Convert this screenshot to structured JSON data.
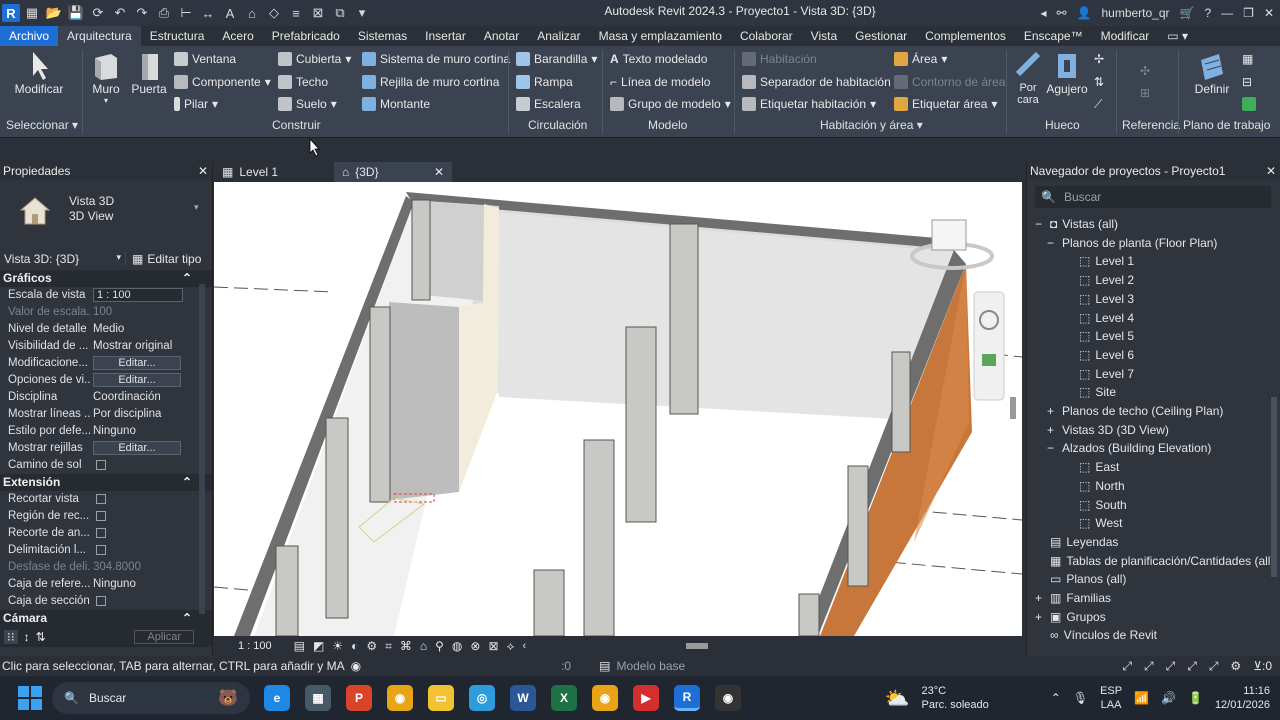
{
  "window": {
    "title": "Autodesk Revit 2024.3 - Proyecto1 - Vista 3D: {3D}",
    "user": "humberto_qr"
  },
  "menu": {
    "tabs": [
      "Archivo",
      "Arquitectura",
      "Estructura",
      "Acero",
      "Prefabricado",
      "Sistemas",
      "Insertar",
      "Anotar",
      "Analizar",
      "Masa y emplazamiento",
      "Colaborar",
      "Vista",
      "Gestionar",
      "Complementos",
      "Enscape™",
      "Modificar"
    ],
    "active_tab": "Arquitectura"
  },
  "ribbon": {
    "select": {
      "big": "Modificar",
      "panel": "Seleccionar"
    },
    "build": {
      "wall": "Muro",
      "door": "Puerta",
      "window": "Ventana",
      "component": "Componente",
      "column": "Pilar",
      "roof": "Cubierta",
      "ceiling": "Techo",
      "floor": "Suelo",
      "curtain_system": "Sistema de muro cortina",
      "curtain_grid": "Rejilla de muro cortina",
      "mullion": "Montante",
      "panel": "Construir"
    },
    "circulation": {
      "railing": "Barandilla",
      "ramp": "Rampa",
      "stair": "Escalera",
      "panel": "Circulación"
    },
    "model": {
      "text": "Texto modelado",
      "line": "Línea de modelo",
      "group": "Grupo de modelo",
      "panel": "Modelo"
    },
    "room_area": {
      "room": "Habitación",
      "separator": "Separador  de habitación",
      "tag_room": "Etiquetar  habitación",
      "area": "Área",
      "area_boundary": "Contorno  de área",
      "tag_area": "Etiquetar  área",
      "panel": "Habitación y área"
    },
    "opening": {
      "by_face": "Por cara",
      "shaft": "Agujero",
      "panel": "Hueco"
    },
    "datum": {
      "panel": "Referencia"
    },
    "workplane": {
      "set": "Definir",
      "panel": "Plano de trabajo"
    }
  },
  "properties": {
    "title": "Propiedades",
    "type_name": "Vista 3D",
    "type_sub": "3D View",
    "selector": "Vista 3D: {3D}",
    "edit_type": "Editar tipo",
    "sections": {
      "graphics": "Gráficos",
      "extents": "Extensión",
      "camera": "Cámara"
    },
    "graphics_rows": [
      {
        "k": "Escala de vista",
        "v": "1 : 100",
        "kind": "input"
      },
      {
        "k": "Valor de escala...",
        "v": "100",
        "kind": "dis"
      },
      {
        "k": "Nivel de detalle",
        "v": "Medio",
        "kind": "text"
      },
      {
        "k": "Visibilidad de ...",
        "v": "Mostrar original",
        "kind": "text"
      },
      {
        "k": "Modificacione...",
        "v": "Editar...",
        "kind": "button"
      },
      {
        "k": "Opciones de vi...",
        "v": "Editar...",
        "kind": "button"
      },
      {
        "k": "Disciplina",
        "v": "Coordinación",
        "kind": "text"
      },
      {
        "k": "Mostrar líneas ...",
        "v": "Por disciplina",
        "kind": "text"
      },
      {
        "k": "Estilo por defe...",
        "v": "Ninguno",
        "kind": "text"
      },
      {
        "k": "Mostrar rejillas",
        "v": "Editar...",
        "kind": "button"
      },
      {
        "k": "Camino de sol",
        "v": "",
        "kind": "check"
      }
    ],
    "extent_rows": [
      {
        "k": "Recortar vista",
        "v": "",
        "kind": "check"
      },
      {
        "k": "Región de rec...",
        "v": "",
        "kind": "check"
      },
      {
        "k": "Recorte de an...",
        "v": "",
        "kind": "check"
      },
      {
        "k": "Delimitación l...",
        "v": "",
        "kind": "check"
      },
      {
        "k": "Desfase de deli...",
        "v": "304.8000",
        "kind": "dis"
      },
      {
        "k": "Caja de refere...",
        "v": "Ninguno",
        "kind": "text"
      },
      {
        "k": "Caja de sección",
        "v": "",
        "kind": "check"
      }
    ],
    "apply": "Aplicar"
  },
  "view_tabs": [
    {
      "label": "Level 1",
      "active": false
    },
    {
      "label": "{3D}",
      "active": true
    }
  ],
  "view_bar": {
    "scale": "1 : 100"
  },
  "browser": {
    "title": "Navegador de proyectos - Proyecto1",
    "search_placeholder": "Buscar",
    "views_all": "Vistas (all)",
    "floor_plans": "Planos de planta (Floor Plan)",
    "floor_items": [
      "Level 1",
      "Level 2",
      "Level 3",
      "Level 4",
      "Level 5",
      "Level 6",
      "Level 7",
      "Site"
    ],
    "ceiling_plans": "Planos de techo (Ceiling Plan)",
    "views_3d": "Vistas 3D (3D View)",
    "elevations": "Alzados (Building Elevation)",
    "elevation_items": [
      "East",
      "North",
      "South",
      "West"
    ],
    "legends": "Leyendas",
    "schedules": "Tablas de planificación/Cantidades (all)",
    "sheets": "Planos (all)",
    "families": "Familias",
    "groups": "Grupos",
    "links": "Vínculos de Revit"
  },
  "status": {
    "hint": "Clic para seleccionar, TAB para alternar, CTRL para añadir y MA",
    "count": ":0",
    "model": "Modelo base",
    "filter_count": ":0"
  },
  "taskbar": {
    "search": "Buscar",
    "temp": "23°C",
    "weather": "Parc. soleado",
    "lang": "ESP",
    "lang2": "LAA",
    "time": "11:16",
    "date": "12/01/2026"
  },
  "colors": {
    "accent": "#1d6fd6",
    "chrome": "#3b4350",
    "wall_orange": "#c8773c"
  }
}
